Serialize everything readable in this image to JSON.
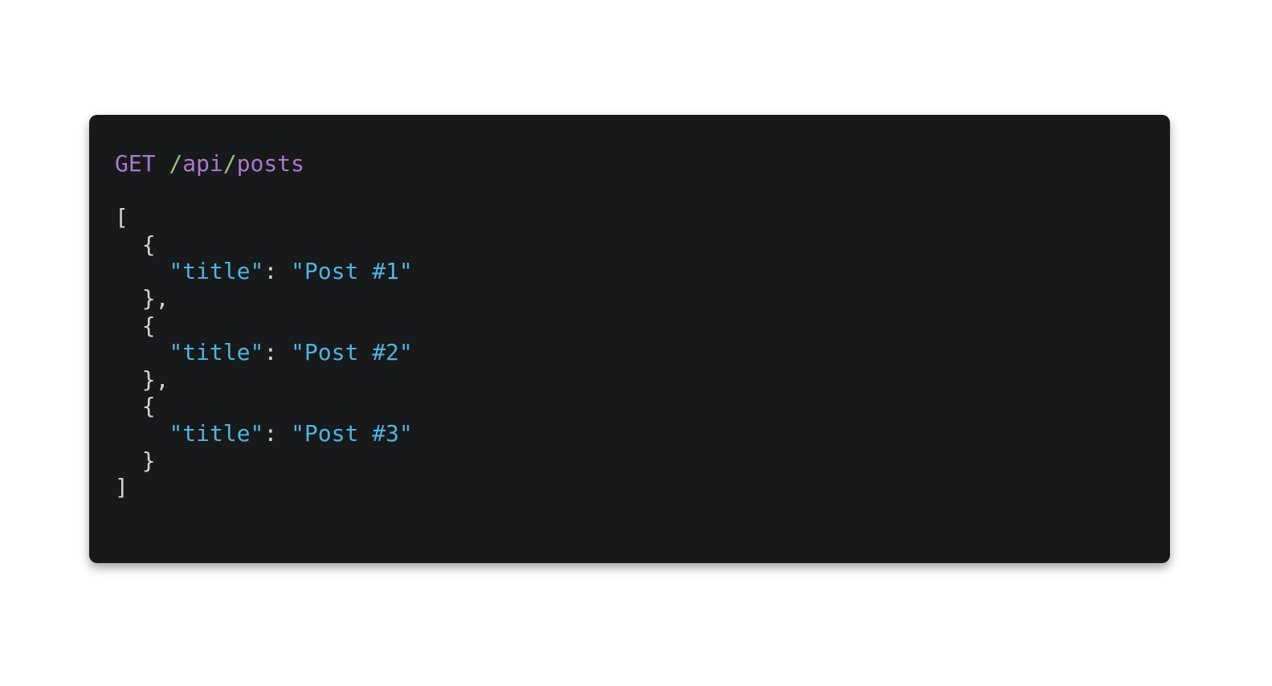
{
  "request": {
    "method": "GET",
    "path_segments": [
      "api",
      "posts"
    ],
    "slash": "/"
  },
  "response": {
    "open_bracket": "[",
    "close_bracket": "]",
    "open_brace": "{",
    "close_brace": "}",
    "close_brace_comma": "},",
    "key_quoted": "\"title\"",
    "colon": ": ",
    "items": [
      {
        "title_quoted": "\"Post #1\""
      },
      {
        "title_quoted": "\"Post #2\""
      },
      {
        "title_quoted": "\"Post #3\""
      }
    ]
  },
  "colors": {
    "background": "#18191b",
    "method": "#a77bca",
    "slash": "#98c379",
    "string": "#4fb3e0",
    "punctuation": "#d4d4d4"
  }
}
